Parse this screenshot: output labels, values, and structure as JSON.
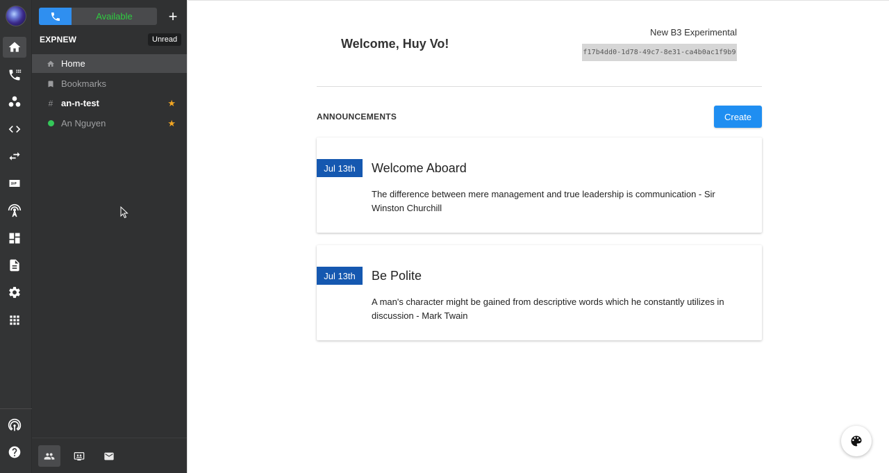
{
  "call": {
    "status": "Available"
  },
  "workspace": {
    "name": "EXPNEW",
    "unread_label": "Unread"
  },
  "nav": {
    "items": [
      {
        "label": "Home"
      },
      {
        "label": "Bookmarks"
      },
      {
        "label": "an-n-test"
      },
      {
        "label": "An Nguyen"
      }
    ]
  },
  "rail_icons": [
    "home-icon",
    "calls-icon",
    "teams-icon",
    "code-icon",
    "transfer-icon",
    "sip-icon",
    "antenna-icon",
    "dashboard-icon",
    "document-icon",
    "settings-icon",
    "apps-icon",
    "broadcast-icon",
    "help-icon"
  ],
  "header": {
    "welcome": "Welcome, Huy Vo!",
    "environment_name": "New B3 Experimental",
    "environment_id": "f17b4dd0-1d78-49c7-8e31-ca4b0ac1f9b9"
  },
  "announcements": {
    "title": "ANNOUNCEMENTS",
    "create_label": "Create",
    "items": [
      {
        "date": "Jul 13th",
        "title": "Welcome Aboard",
        "body": "The difference between mere management and true leadership is communication - Sir Winston Churchill"
      },
      {
        "date": "Jul 13th",
        "title": "Be Polite",
        "body": "A man's character might be gained from descriptive words which he constantly utilizes in discussion - Mark Twain"
      }
    ]
  },
  "colors": {
    "accent": "#1f8ef1",
    "date_badge": "#1558b0",
    "available": "#2ecc40",
    "star": "#f2a623"
  }
}
